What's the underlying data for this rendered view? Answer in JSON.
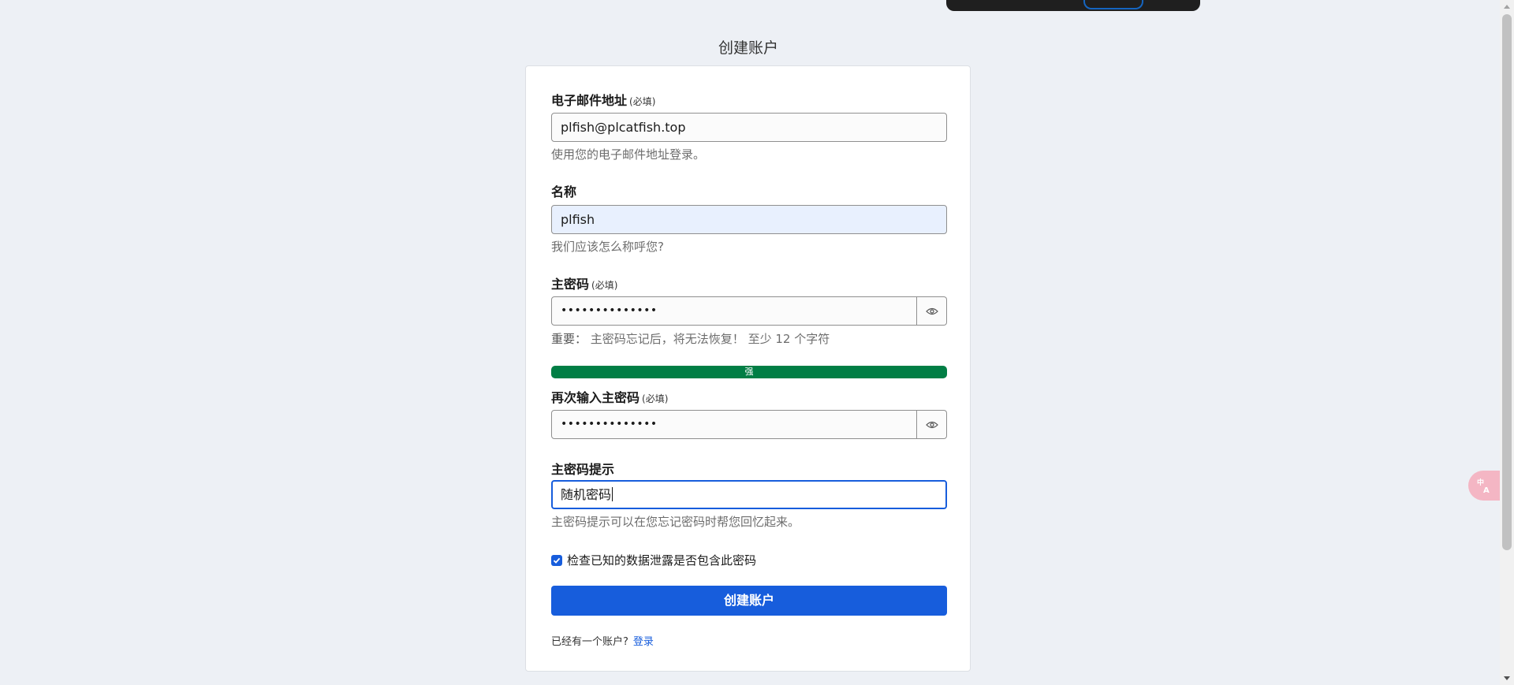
{
  "page": {
    "title": "创建账户"
  },
  "form": {
    "email": {
      "label": "电子邮件地址",
      "required": "(必填)",
      "value": "plfish@plcatfish.top",
      "hint": "使用您的电子邮件地址登录。"
    },
    "name": {
      "label": "名称",
      "value": "plfish",
      "hint": "我们应该怎么称呼您?"
    },
    "master_password": {
      "label": "主密码",
      "required": "(必填)",
      "value": "••••••••••••••",
      "hint_prefix": "重要：",
      "hint_text": "主密码忘记后，将无法恢复！ 至少 12 个字符",
      "toggle_icon": "eye-icon"
    },
    "strength": {
      "label": "强",
      "color": "#017e45"
    },
    "confirm_password": {
      "label": "再次输入主密码",
      "required": "(必填)",
      "value": "••••••••••••••",
      "toggle_icon": "eye-icon"
    },
    "password_hint": {
      "label": "主密码提示",
      "value": "随机密码",
      "hint": "主密码提示可以在您忘记密码时帮您回忆起来。"
    },
    "breach_check": {
      "label": "检查已知的数据泄露是否包含此密码",
      "checked": true
    },
    "submit_label": "创建账户",
    "footer": {
      "text": "已经有一个账户?",
      "login_link": "登录"
    }
  },
  "colors": {
    "accent": "#175ddc",
    "background": "#edf0f5",
    "strength_strong": "#017e45",
    "translate_button": "#f4b6c4"
  },
  "translate_button": {
    "icon": "translate-icon"
  }
}
